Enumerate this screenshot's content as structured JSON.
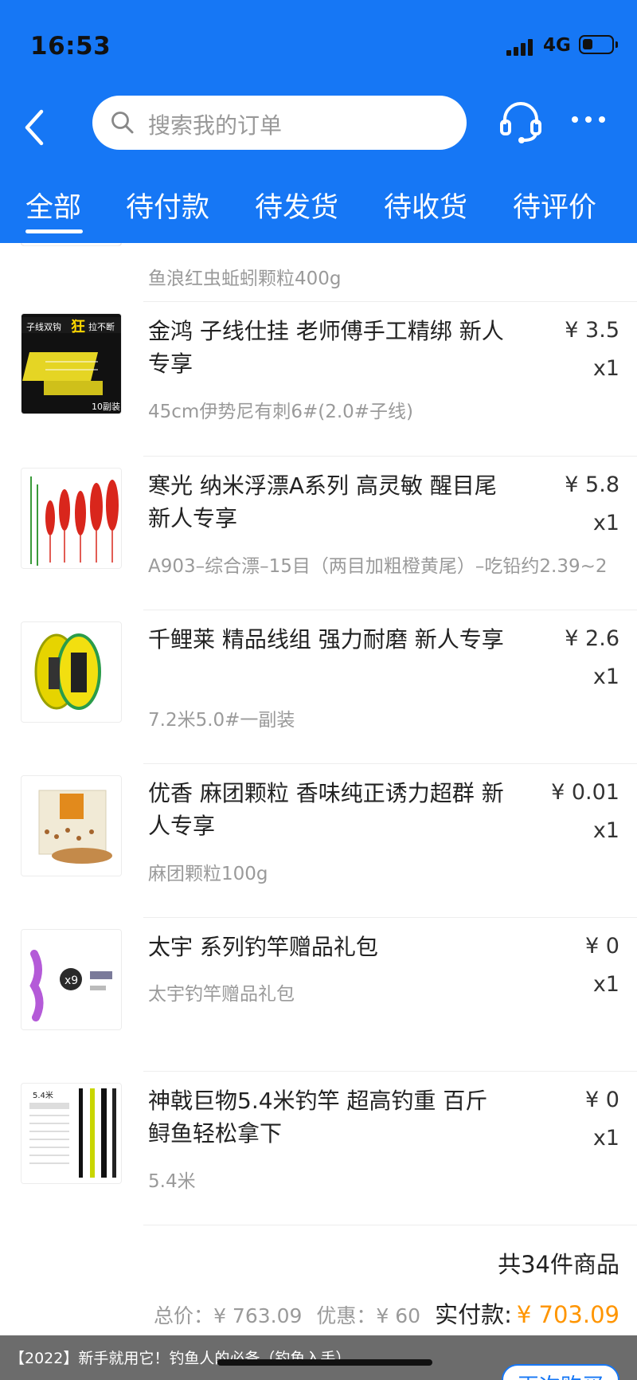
{
  "status_bar": {
    "time": "16:53",
    "network": "4G",
    "battery_level": 0.35
  },
  "nav": {
    "search_placeholder": "搜索我的订单"
  },
  "tabs": [
    {
      "label": "全部",
      "active": true
    },
    {
      "label": "待付款",
      "active": false
    },
    {
      "label": "待发货",
      "active": false
    },
    {
      "label": "待收货",
      "active": false
    },
    {
      "label": "待评价",
      "active": false
    }
  ],
  "items": [
    {
      "title": "",
      "spec": "鱼浪红虫蚯蚓颗粒400g",
      "price": "",
      "qty": "",
      "image": "red-pellets-image"
    },
    {
      "title": "金鸿 子线仕挂 老师傅手工精绑 新人专享",
      "spec": "45cm伊势尼有刺6#(2.0#子线)",
      "price": "¥ 3.5",
      "qty": "x1",
      "image": "hook-line-image",
      "image_text": [
        "子线双钩",
        "狂",
        "拉不断",
        "10副装"
      ]
    },
    {
      "title": "寒光 纳米浮漂A系列 高灵敏 醒目尾 新人专享",
      "spec": "A903–综合漂–15目（两目加粗橙黄尾）–吃铅约2.39~2",
      "price": "¥ 5.8",
      "qty": "x1",
      "image": "float-image"
    },
    {
      "title": "千鲤莱 精品线组 强力耐磨  新人专享",
      "spec": "7.2米5.0#一副装",
      "price": "¥ 2.6",
      "qty": "x1",
      "image": "line-spool-image"
    },
    {
      "title": "优香 麻团颗粒 香味纯正诱力超群 新人专享",
      "spec": "麻团颗粒100g",
      "price": "¥ 0.01",
      "qty": "x1",
      "image": "bait-bag-image"
    },
    {
      "title": "太宇 系列钓竿赠品礼包",
      "spec": "太宇钓竿赠品礼包",
      "price": "¥ 0",
      "qty": "x1",
      "image": "gift-pack-image"
    },
    {
      "title": "神戟巨物5.4米钓竿 超高钓重 百斤鲟鱼轻松拿下",
      "spec": "5.4米",
      "price": "¥ 0",
      "qty": "x1",
      "image": "fishing-rod-image",
      "image_text": [
        "5.4米"
      ]
    }
  ],
  "summary": {
    "count": "共34件商品",
    "total_label": "总价：",
    "total_value": "¥ 763.09",
    "discount_label": "优惠：",
    "discount_value": "¥ 60",
    "paid_label": "实付款:",
    "paid_value": "¥ 703.09"
  },
  "banner": {
    "text": "【2022】新手就用它！钓鱼人的必备（钓鱼入手）"
  },
  "actions": {
    "rebuy": "再次购买"
  },
  "colors": {
    "brand": "#1677f5",
    "accent": "#ff9500"
  }
}
